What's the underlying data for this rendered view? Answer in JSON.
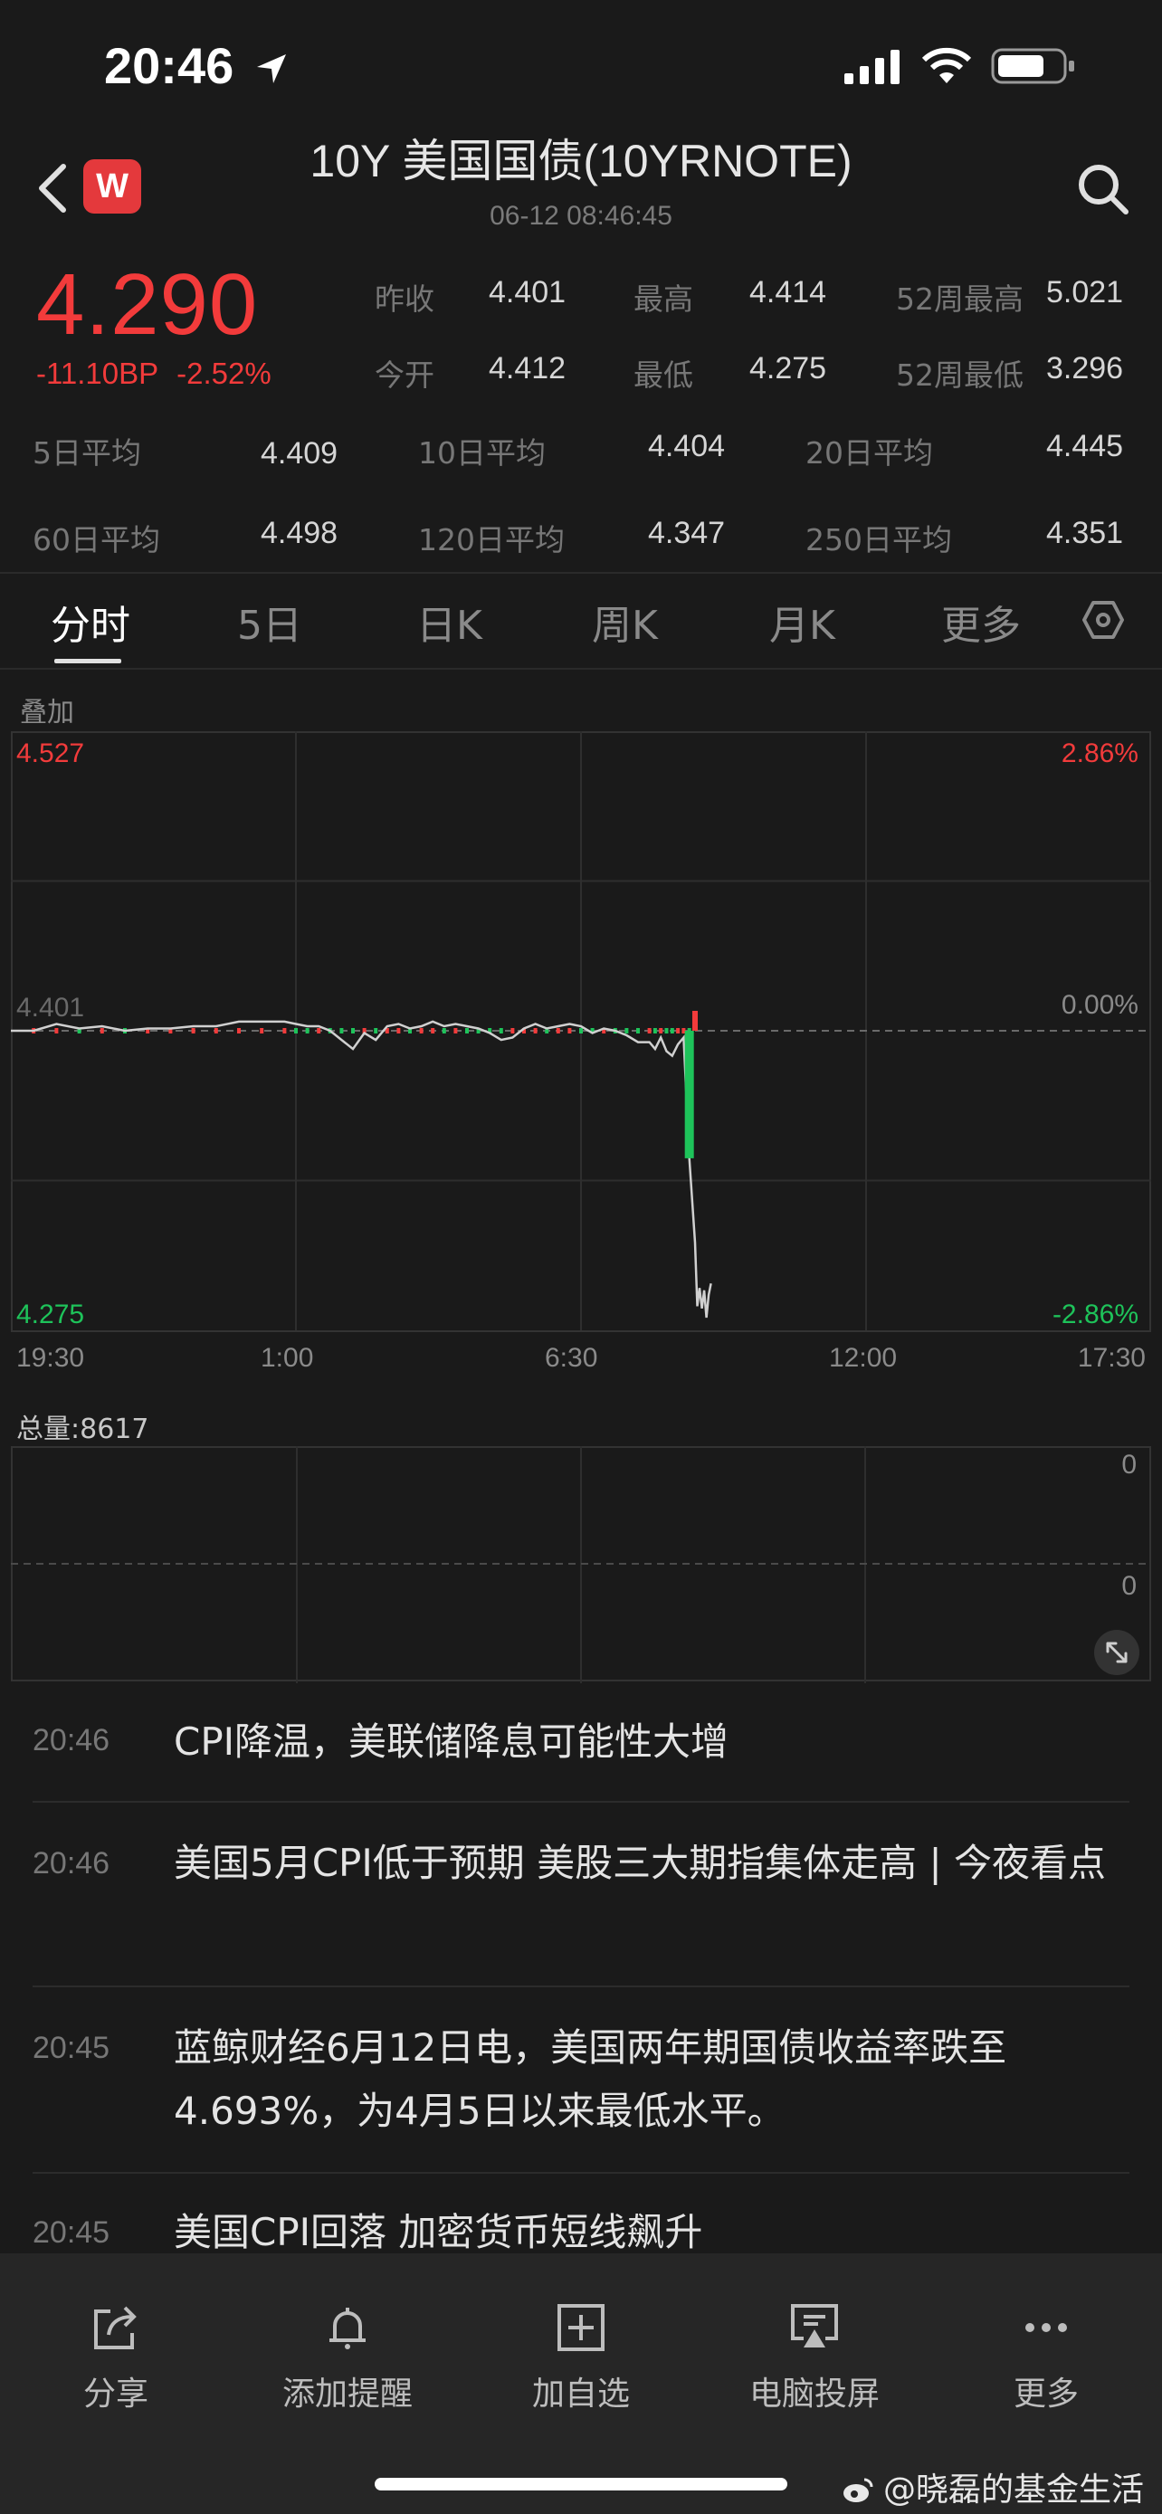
{
  "status_bar": {
    "time": "20:46"
  },
  "header": {
    "logo_text": "W",
    "title": "10Y 美国国债(10YRNOTE)",
    "subtitle": "06-12 08:46:45"
  },
  "quote": {
    "price": "4.290",
    "change_bp": "-11.10BP",
    "change_pct": "-2.52%",
    "stats": [
      {
        "label": "昨收",
        "value": "4.401"
      },
      {
        "label": "最高",
        "value": "4.414"
      },
      {
        "label": "52周最高",
        "value": "5.021"
      },
      {
        "label": "今开",
        "value": "4.412"
      },
      {
        "label": "最低",
        "value": "4.275"
      },
      {
        "label": "52周最低",
        "value": "3.296"
      }
    ],
    "averages": [
      {
        "label": "5日平均",
        "value": "4.409"
      },
      {
        "label": "10日平均",
        "value": "4.404"
      },
      {
        "label": "20日平均",
        "value": "4.445"
      },
      {
        "label": "60日平均",
        "value": "4.498"
      },
      {
        "label": "120日平均",
        "value": "4.347"
      },
      {
        "label": "250日平均",
        "value": "4.351"
      }
    ]
  },
  "tabs": [
    {
      "label": "分时",
      "active": true
    },
    {
      "label": "5日"
    },
    {
      "label": "日K"
    },
    {
      "label": "周K"
    },
    {
      "label": "月K"
    },
    {
      "label": "更多"
    }
  ],
  "overlay_label": "叠加",
  "volume_label": "总量:8617",
  "volume_axis": [
    "0",
    "0"
  ],
  "chart_data": {
    "type": "line",
    "y_labels": {
      "top": "4.527",
      "mid": "4.401",
      "bottom": "4.275"
    },
    "pct_labels": {
      "top": "2.86%",
      "mid": "0.00%",
      "bottom": "-2.86%"
    },
    "x_ticks": [
      "19:30",
      "1:00",
      "6:30",
      "12:00",
      "17:30"
    ],
    "ylim": [
      4.275,
      4.527
    ],
    "reference": 4.401,
    "series": [
      {
        "x": [
          0,
          0.02,
          0.04,
          0.06,
          0.08,
          0.1,
          0.12,
          0.14,
          0.16,
          0.18,
          0.2,
          0.22,
          0.24,
          0.25,
          0.26,
          0.27,
          0.28,
          0.29,
          0.3,
          0.31,
          0.32,
          0.33,
          0.34,
          0.35,
          0.36,
          0.37,
          0.38,
          0.39,
          0.4,
          0.41,
          0.42,
          0.43,
          0.44,
          0.45,
          0.46,
          0.47,
          0.48,
          0.49,
          0.5,
          0.51,
          0.52,
          0.53,
          0.54,
          0.55,
          0.56,
          0.565,
          0.57,
          0.575,
          0.58,
          0.585,
          0.59,
          0.595,
          0.6,
          0.602,
          0.604,
          0.606,
          0.608,
          0.61,
          0.612,
          0.614
        ],
        "y": [
          4.401,
          4.401,
          4.404,
          4.402,
          4.403,
          4.401,
          4.402,
          4.402,
          4.403,
          4.403,
          4.405,
          4.405,
          4.405,
          4.404,
          4.403,
          4.403,
          4.401,
          4.397,
          4.393,
          4.4,
          4.397,
          4.403,
          4.404,
          4.402,
          4.403,
          4.405,
          4.403,
          4.404,
          4.403,
          4.402,
          4.4,
          4.397,
          4.398,
          4.402,
          4.404,
          4.402,
          4.403,
          4.404,
          4.403,
          4.4,
          4.402,
          4.401,
          4.399,
          4.396,
          4.396,
          4.393,
          4.398,
          4.392,
          4.39,
          4.395,
          4.398,
          4.345,
          4.308,
          4.28,
          4.288,
          4.279,
          4.287,
          4.275,
          4.285,
          4.29
        ]
      }
    ]
  },
  "news": [
    {
      "time": "20:46",
      "title": "CPI降温，美联储降息可能性大增"
    },
    {
      "time": "20:46",
      "title": "美国5月CPI低于预期 美股三大期指集体走高 | 今夜看点"
    },
    {
      "time": "20:45",
      "title": "蓝鲸财经6月12日电，美国两年期国债收益率跌至4.693%，为4月5日以来最低水平。"
    },
    {
      "time": "20:45",
      "title": "美国CPI回落 加密货币短线飙升"
    }
  ],
  "bottom_nav": [
    {
      "label": "分享",
      "icon": "share-icon"
    },
    {
      "label": "添加提醒",
      "icon": "bell-icon"
    },
    {
      "label": "加自选",
      "icon": "add-watchlist-icon"
    },
    {
      "label": "电脑投屏",
      "icon": "screen-cast-icon"
    },
    {
      "label": "更多",
      "icon": "more-icon"
    }
  ],
  "watermark": "@晓磊的基金生活",
  "colors": {
    "up": "#f23b3b",
    "down": "#1ec35a",
    "line": "#d0d0d0"
  }
}
